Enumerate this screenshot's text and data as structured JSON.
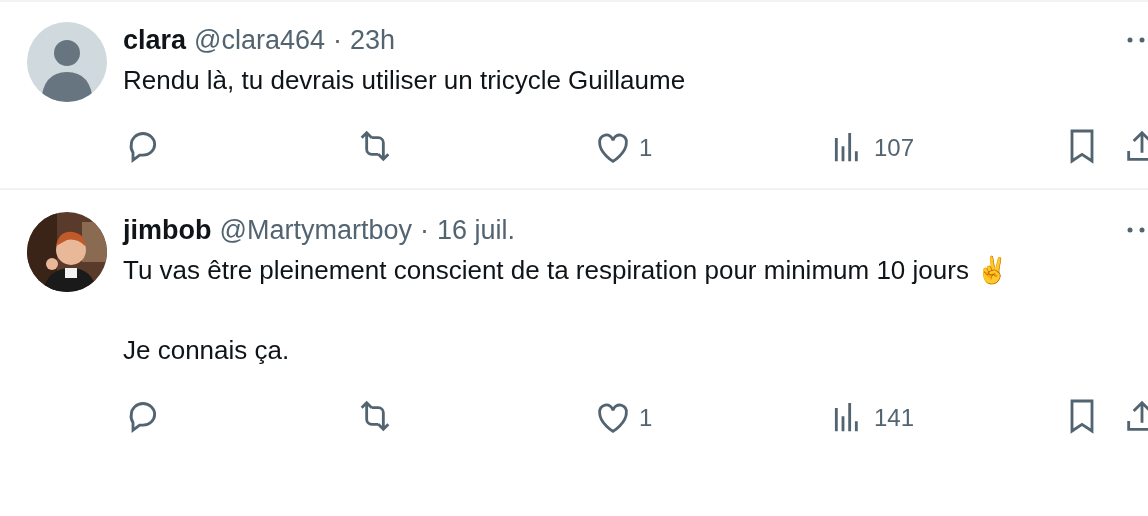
{
  "posts": [
    {
      "name": "clara",
      "handle": "@clara464",
      "separator": "·",
      "time": "23h",
      "avatar": {
        "kind": "default"
      },
      "paragraphs": [
        "Rendu là, tu devrais utiliser un tricycle Guillaume"
      ],
      "likes": "1",
      "views": "107"
    },
    {
      "name": "jimbob",
      "handle": "@Martymartboy",
      "separator": "·",
      "time": "16 juil.",
      "paragraphs": [
        "Tu vas être pleinement conscient de ta respiration pour minimum 10 jours ✌️",
        "Je connais ça."
      ],
      "likes": "1",
      "views": "141"
    }
  ]
}
